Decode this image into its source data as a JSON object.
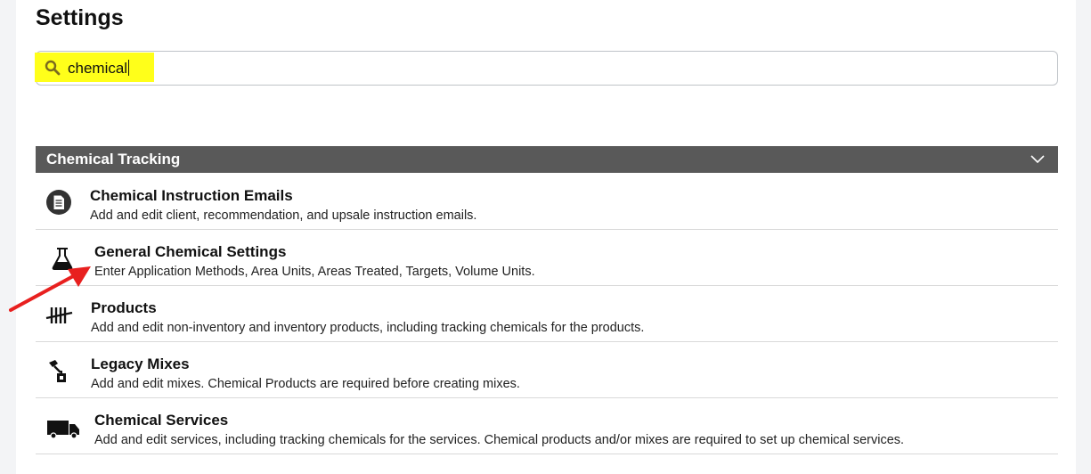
{
  "page": {
    "title": "Settings"
  },
  "search": {
    "value": "chemical",
    "highlight_color": "#ffff1a"
  },
  "section": {
    "title": "Chemical Tracking",
    "header_color": "#595959"
  },
  "items": [
    {
      "title": "Chemical Instruction Emails",
      "description": "Add and edit client, recommendation, and upsale instruction emails.",
      "icon": "document-circle-icon"
    },
    {
      "title": "General Chemical Settings",
      "description": "Enter Application Methods, Area Units, Areas Treated, Targets, Volume Units.",
      "icon": "flask-icon"
    },
    {
      "title": "Products",
      "description": "Add and edit non-inventory and inventory products, including tracking chemicals for the products.",
      "icon": "tally-icon"
    },
    {
      "title": "Legacy Mixes",
      "description": "Add and edit mixes. Chemical Products are required before creating mixes.",
      "icon": "mix-icon"
    },
    {
      "title": "Chemical Services",
      "description": "Add and edit services, including tracking chemicals for the services. Chemical products and/or mixes are required to set up chemical services.",
      "icon": "truck-icon"
    }
  ],
  "annotation": {
    "arrow_color": "#e8201f"
  }
}
